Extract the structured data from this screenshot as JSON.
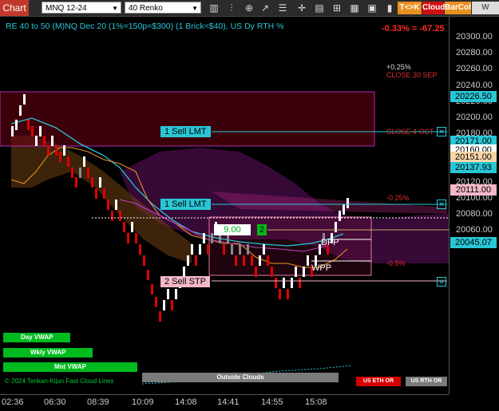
{
  "toolbar": {
    "tab_label": "Chart",
    "instrument": "MNQ 12-24",
    "bar_type": "40 Renko",
    "tk_label": "T<>K",
    "cloud_label": "Cloud",
    "barcol_label": "BarCol",
    "vwap_label": "W VWA"
  },
  "title": "RE 40 to 50 (M)NQ Dec 20 (1%=150p=$300) (1 Brick=$40), US Dy RTH %",
  "change": "-0.33% = -67.25",
  "price_ticks": [
    "20300.00",
    "20280.00",
    "20260.00",
    "20240.00",
    "20220.00",
    "20200.00",
    "20180.00",
    "20160.00",
    "20140.00",
    "20120.00",
    "20100.00",
    "20080.00",
    "20060.00",
    "20040.00"
  ],
  "price_boxes": {
    "sell_lmt_1": "20226.50",
    "sell_lmt_2": "20171.00",
    "last": "20160.00",
    "avg": "20151.00",
    "vwap": "20137.93",
    "sell_stp": "20111.00",
    "bottom": "20045.07"
  },
  "time_ticks": [
    "02:36",
    "06:30",
    "08:39",
    "10:09",
    "14:08",
    "14:41",
    "14:55",
    "15:08"
  ],
  "orders": {
    "sell_lmt_upper": "1 Sell LMT",
    "sell_lmt_lower": "1 Sell LMT",
    "sell_stp": "2 Sell STP",
    "qty_price": "9.00",
    "qty": "2"
  },
  "annotations": {
    "plus_025": "+0.25%",
    "close_30sep": "CLOSE 30 SEP",
    "close_4oct": "CLOSE 4 OCT",
    "minus_025": "-0.25%",
    "minus_05": "-0.5%",
    "dpp": "DPP",
    "wpp": "WPP",
    "outside_clouds": "Outside Clouds",
    "watermark": "© 2024 Tenkan-Kijun Fast Cloud Lines"
  },
  "buttons": {
    "day_vwap": "Day VWAP",
    "wkly_vwap": "Wkly VWAP",
    "mnt_vwap": "Mnt VWAP",
    "us_eth_or": "US ETH OR",
    "us_rth_or": "US RTH OR"
  },
  "colors": {
    "up_brick": "#ffffff",
    "down_brick": "#e00000",
    "cyan": "#29c6d6",
    "orange": "#e8901f",
    "magenta": "#c040c0"
  }
}
